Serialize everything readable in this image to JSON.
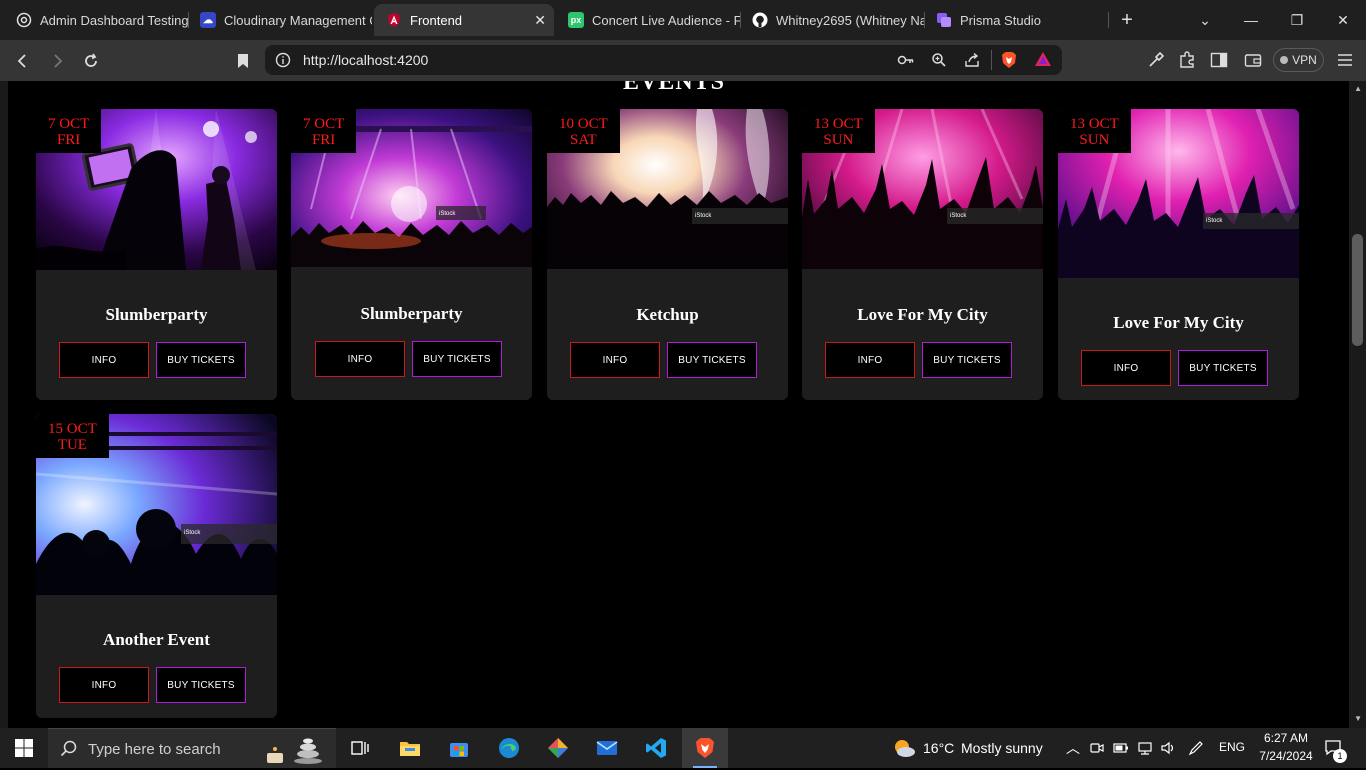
{
  "browser": {
    "tabs": [
      {
        "title": "Admin Dashboard Testing",
        "icon": "openai-icon",
        "active": false
      },
      {
        "title": "Cloudinary Management C",
        "icon": "cloudinary-icon",
        "active": false
      },
      {
        "title": "Frontend",
        "icon": "angular-icon",
        "active": true
      },
      {
        "title": "Concert Live Audience - Fr",
        "icon": "pixabay-icon",
        "active": false
      },
      {
        "title": "Whitney2695 (Whitney Na",
        "icon": "github-icon",
        "active": false
      },
      {
        "title": "Prisma Studio",
        "icon": "prisma-icon",
        "active": false
      }
    ],
    "new_tab": "+",
    "url": "http://localhost:4200",
    "vpn_label": "VPN"
  },
  "page": {
    "heading": "EVENTS",
    "events": [
      {
        "day": "7 OCT",
        "weekday": "FRI",
        "title": "Slumberparty",
        "info": "INFO",
        "buy": "BUY TICKETS"
      },
      {
        "day": "7 OCT",
        "weekday": "FRI",
        "title": "Slumberparty",
        "info": "INFO",
        "buy": "BUY TICKETS"
      },
      {
        "day": "10 OCT",
        "weekday": "SAT",
        "title": "Ketchup",
        "info": "INFO",
        "buy": "BUY TICKETS"
      },
      {
        "day": "13 OCT",
        "weekday": "SUN",
        "title": "Love For My City",
        "info": "INFO",
        "buy": "BUY TICKETS"
      },
      {
        "day": "13 OCT",
        "weekday": "SUN",
        "title": "Love For My City",
        "info": "INFO",
        "buy": "BUY TICKETS"
      },
      {
        "day": "15 OCT",
        "weekday": "TUE",
        "title": "Another Event",
        "info": "INFO",
        "buy": "BUY TICKETS"
      }
    ],
    "watermarks": [
      "iStock",
      "iStock",
      "iStock",
      "iStock",
      "iStock"
    ]
  },
  "taskbar": {
    "search_placeholder": "Type here to search",
    "weather_temp": "16°C",
    "weather_desc": "Mostly sunny",
    "language": "ENG",
    "time": "6:27 AM",
    "date": "7/24/2024",
    "notification_count": "1"
  },
  "colors": {
    "date_red": "#ff1a1a",
    "info_border": "#c9191d",
    "buy_border": "#b11ad9",
    "card_bg": "#1e1e1e"
  }
}
